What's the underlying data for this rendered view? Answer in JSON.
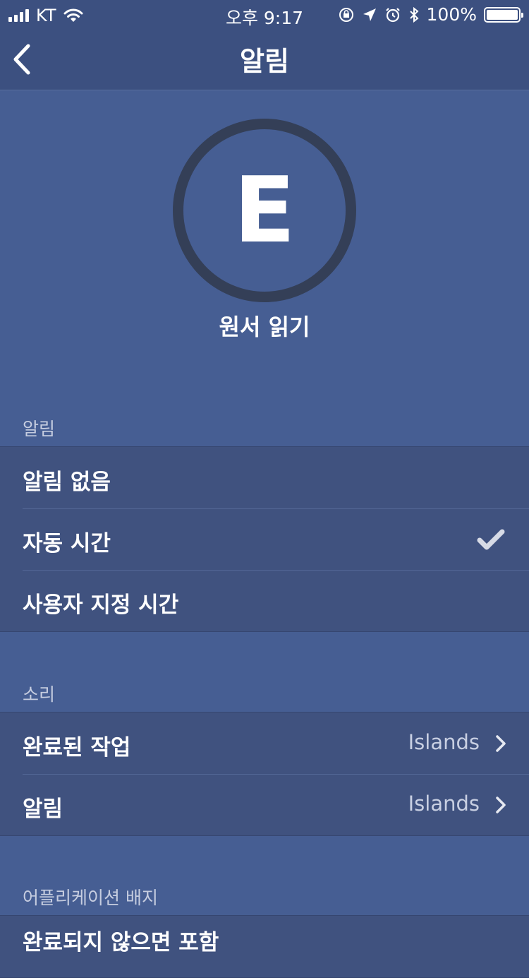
{
  "status_bar": {
    "carrier": "KT",
    "time": "오후 9:17",
    "battery": "100%",
    "battery_level": 1.0
  },
  "nav": {
    "title": "알림",
    "back_icon": "chevron-left-icon"
  },
  "hero": {
    "letter": "E",
    "name": "원서 읽기",
    "ring_color": "#343f57"
  },
  "sections": {
    "notification": {
      "header": "알림",
      "items": [
        {
          "label": "알림 없음",
          "checked": false
        },
        {
          "label": "자동 시간",
          "checked": true
        },
        {
          "label": "사용자 지정 시간",
          "checked": false
        }
      ]
    },
    "sound": {
      "header": "소리",
      "items": [
        {
          "label": "완료된 작업",
          "value": "Islands"
        },
        {
          "label": "알림",
          "value": "Islands"
        }
      ]
    },
    "badge": {
      "header": "어플리케이션 배지",
      "items": [
        {
          "label": "완료되지 않으면 포함"
        }
      ]
    }
  },
  "colors": {
    "background": "#465e93",
    "bar": "#3c5080",
    "row": "#40527f",
    "check": "#d7dbe6"
  }
}
